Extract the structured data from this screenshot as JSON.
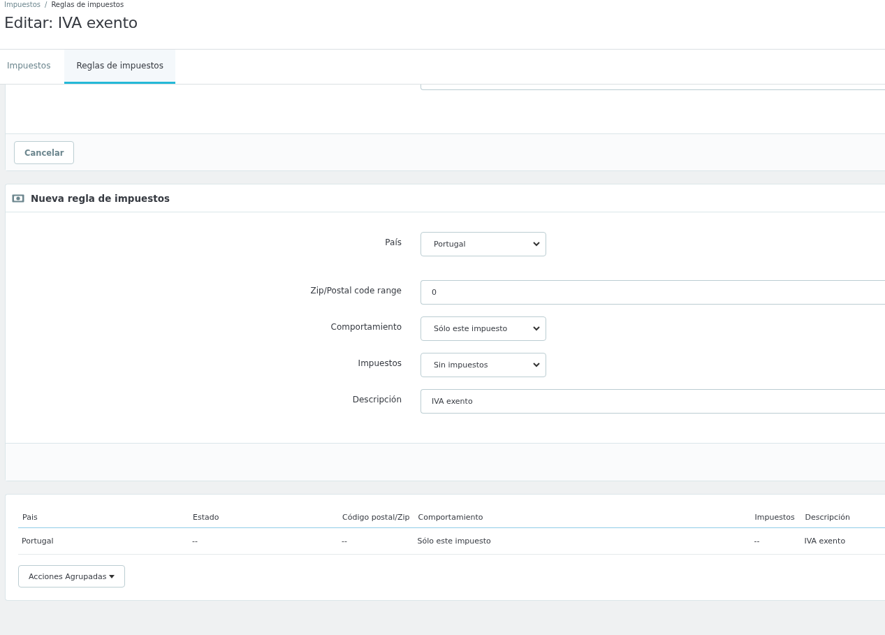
{
  "breadcrumb_separator": "/",
  "breadcrumb": [
    {
      "label": "Impuestos",
      "current": false
    },
    {
      "label": "Reglas de impuestos",
      "current": true
    }
  ],
  "page_title": "Editar: IVA exento",
  "tabs": [
    {
      "label": "Impuestos",
      "selected": false
    },
    {
      "label": "Reglas de impuestos",
      "selected": true
    }
  ],
  "top_panel": {
    "cancel_button": "Cancelar"
  },
  "rule_form": {
    "title": "Nueva regla de impuestos",
    "fields": [
      {
        "kind": "select",
        "label": "País",
        "value": "Portugal"
      },
      {
        "kind": "text",
        "label": "Zip/Postal code range",
        "value": "0"
      },
      {
        "kind": "select",
        "label": "Comportamiento",
        "value": "Sólo este impuesto"
      },
      {
        "kind": "select",
        "label": "Impuestos",
        "value": "Sin impuestos"
      },
      {
        "kind": "text",
        "label": "Descripción",
        "value": "IVA exento"
      }
    ]
  },
  "table": {
    "columns": [
      "Pais",
      "Estado",
      "Código postal/Zip",
      "Comportamiento",
      "Impuestos",
      "Descripción"
    ],
    "rows": [
      [
        "Portugal",
        "--",
        "--",
        "Sólo este impuesto",
        "--",
        "IVA exento"
      ]
    ]
  },
  "bulk_actions_button": "Acciones Agrupadas"
}
